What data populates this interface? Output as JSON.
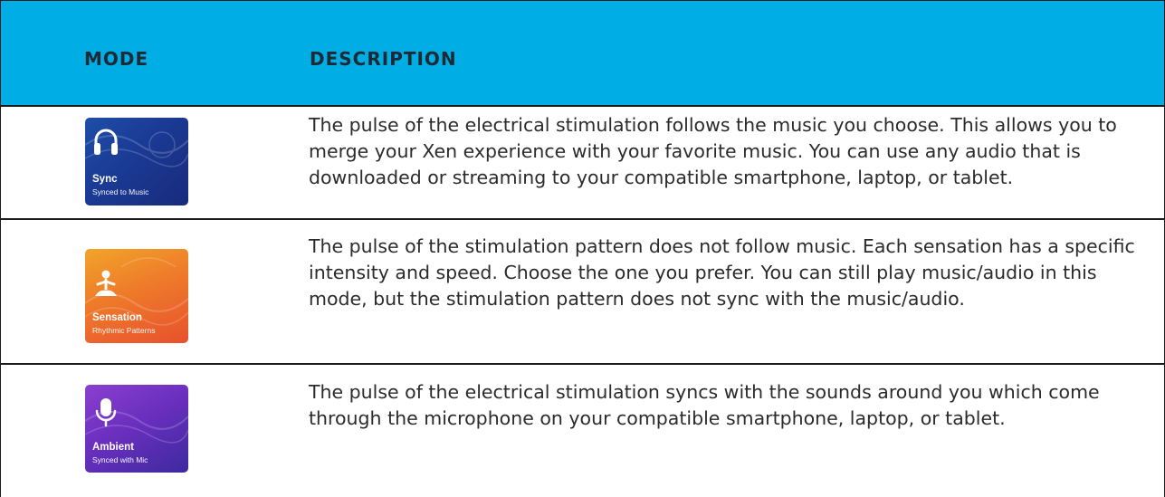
{
  "header": {
    "mode_label": "MODE",
    "description_label": "DESCRIPTION"
  },
  "colors": {
    "header_bg": "#00ade4",
    "sync_tile": "#1a3a94",
    "sensation_tile": "#ee7a2a",
    "ambient_tile": "#6b2fbf"
  },
  "rows": [
    {
      "tile_title": "Sync",
      "tile_subtitle": "Synced to Music",
      "icon": "headphones-icon",
      "description": "The pulse of the electrical stimulation follows the music you choose. This allows you to merge your Xen experience with your favorite music. You can use any audio that is downloaded or streaming to your compatible smartphone, laptop, or tablet."
    },
    {
      "tile_title": "Sensation",
      "tile_subtitle": "Rhythmic Patterns",
      "icon": "meditation-person-icon",
      "description": "The pulse of the stimulation pattern does not follow music. Each sensation has a specific intensity and speed. Choose the one you prefer. You can still play music/audio in this mode, but the stimulation pattern does not sync with the music/audio."
    },
    {
      "tile_title": "Ambient",
      "tile_subtitle": "Synced with Mic",
      "icon": "microphone-icon",
      "description": "The pulse of the electrical stimulation syncs with the sounds around you which come through the microphone on your compatible smartphone, laptop, or tablet."
    }
  ]
}
